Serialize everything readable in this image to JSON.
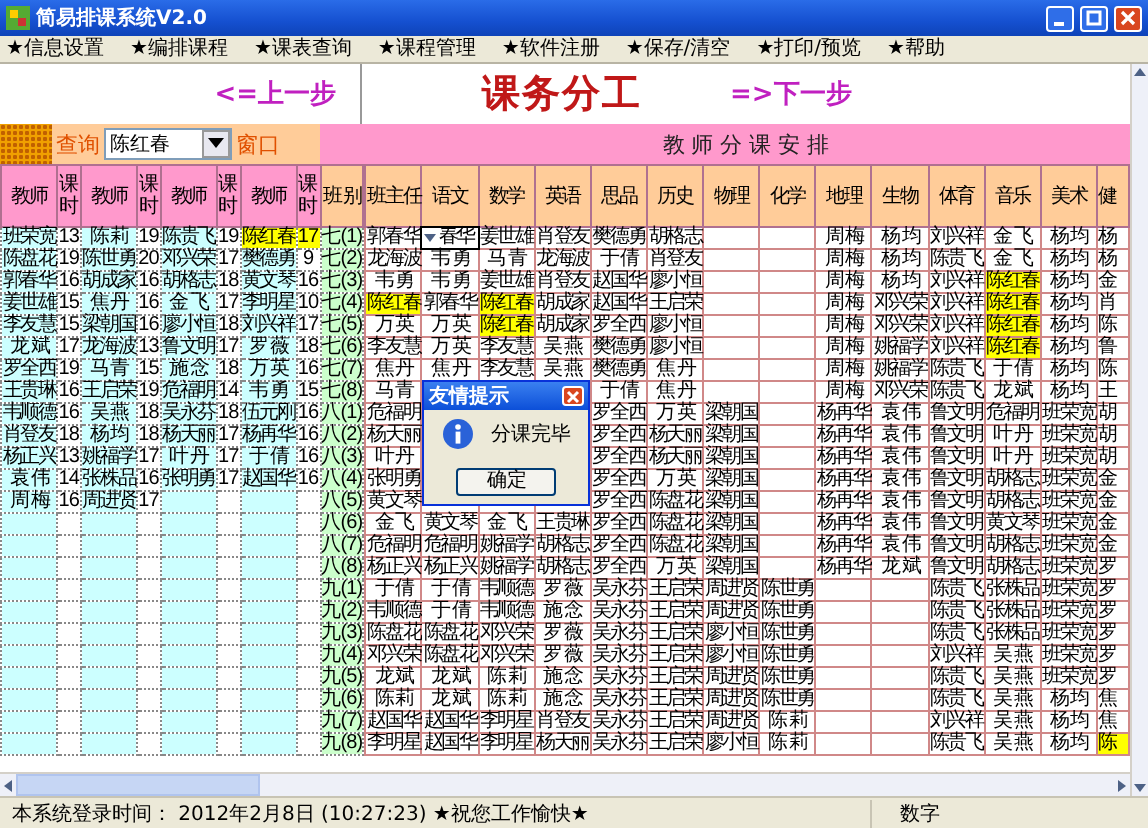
{
  "window": {
    "title": "简易排课系统V2.0"
  },
  "menu": [
    "★信息设置",
    "★编排课程",
    "★课表查询",
    "★课程管理",
    "★软件注册",
    "★保存/清空",
    "★打印/预览",
    "★帮助"
  ],
  "nav": {
    "prev": "<=上一步",
    "title": "课务分工",
    "next": "=>下一步"
  },
  "query": {
    "label": "查询",
    "value": "陈红春",
    "suffix": "窗口"
  },
  "banner": "教 师 分 课 安 排",
  "teacher_table": {
    "columns": [
      "教师",
      "课时",
      "教师",
      "课时",
      "教师",
      "课时",
      "教师",
      "课时",
      "班 别"
    ],
    "rows": [
      {
        "class": "七(1)",
        "entries": [
          {
            "teacher": "班荣宽",
            "hours": "13",
            "highlighted": false
          },
          {
            "teacher": "陈 莉",
            "hours": "19",
            "highlighted": false
          },
          {
            "teacher": "陈贵飞",
            "hours": "19",
            "highlighted": false
          },
          {
            "teacher": "陈红春",
            "hours": "17",
            "highlighted": true
          }
        ]
      },
      {
        "class": "七(2)",
        "entries": [
          {
            "teacher": "陈盘花",
            "hours": "19",
            "highlighted": false
          },
          {
            "teacher": "陈世勇",
            "hours": "20",
            "highlighted": false
          },
          {
            "teacher": "邓兴荣",
            "hours": "17",
            "highlighted": false
          },
          {
            "teacher": "樊德勇",
            "hours": "9",
            "highlighted": false
          }
        ]
      },
      {
        "class": "七(3)",
        "entries": [
          {
            "teacher": "郭春华",
            "hours": "16",
            "highlighted": false
          },
          {
            "teacher": "胡成家",
            "hours": "16",
            "highlighted": false
          },
          {
            "teacher": "胡格志",
            "hours": "18",
            "highlighted": false
          },
          {
            "teacher": "黄文琴",
            "hours": "16",
            "highlighted": false
          }
        ]
      },
      {
        "class": "七(4)",
        "entries": [
          {
            "teacher": "姜世雄",
            "hours": "15",
            "highlighted": false
          },
          {
            "teacher": "焦 丹",
            "hours": "16",
            "highlighted": false
          },
          {
            "teacher": "金 飞",
            "hours": "17",
            "highlighted": false
          },
          {
            "teacher": "李明星",
            "hours": "10",
            "highlighted": false
          }
        ]
      },
      {
        "class": "七(5)",
        "entries": [
          {
            "teacher": "李友慧",
            "hours": "15",
            "highlighted": false
          },
          {
            "teacher": "梁朝国",
            "hours": "16",
            "highlighted": false
          },
          {
            "teacher": "廖小恒",
            "hours": "18",
            "highlighted": false
          },
          {
            "teacher": "刘兴祥",
            "hours": "17",
            "highlighted": false
          }
        ]
      },
      {
        "class": "七(6)",
        "entries": [
          {
            "teacher": "龙 斌",
            "hours": "17",
            "highlighted": false
          },
          {
            "teacher": "龙海波",
            "hours": "13",
            "highlighted": false
          },
          {
            "teacher": "鲁文明",
            "hours": "17",
            "highlighted": false
          },
          {
            "teacher": "罗 薇",
            "hours": "18",
            "highlighted": false
          }
        ]
      },
      {
        "class": "七(7)",
        "entries": [
          {
            "teacher": "罗全西",
            "hours": "19",
            "highlighted": false
          },
          {
            "teacher": "马 青",
            "hours": "15",
            "highlighted": false
          },
          {
            "teacher": "施 念",
            "hours": "18",
            "highlighted": false
          },
          {
            "teacher": "万 英",
            "hours": "16",
            "highlighted": false
          }
        ]
      },
      {
        "class": "七(8)",
        "entries": [
          {
            "teacher": "王贵琳",
            "hours": "16",
            "highlighted": false
          },
          {
            "teacher": "王启荣",
            "hours": "19",
            "highlighted": false
          },
          {
            "teacher": "危福明",
            "hours": "14",
            "highlighted": false
          },
          {
            "teacher": "韦 勇",
            "hours": "15",
            "highlighted": false
          }
        ]
      },
      {
        "class": "八(1)",
        "entries": [
          {
            "teacher": "韦顺德",
            "hours": "16",
            "highlighted": false
          },
          {
            "teacher": "吴 燕",
            "hours": "18",
            "highlighted": false
          },
          {
            "teacher": "吴永芬",
            "hours": "18",
            "highlighted": false
          },
          {
            "teacher": "伍元刚",
            "hours": "16",
            "highlighted": false
          }
        ]
      },
      {
        "class": "八(2)",
        "entries": [
          {
            "teacher": "肖登友",
            "hours": "18",
            "highlighted": false
          },
          {
            "teacher": "杨 均",
            "hours": "18",
            "highlighted": false
          },
          {
            "teacher": "杨天丽",
            "hours": "17",
            "highlighted": false
          },
          {
            "teacher": "杨再华",
            "hours": "16",
            "highlighted": false
          }
        ]
      },
      {
        "class": "八(3)",
        "entries": [
          {
            "teacher": "杨正兴",
            "hours": "13",
            "highlighted": false
          },
          {
            "teacher": "姚福学",
            "hours": "17",
            "highlighted": false
          },
          {
            "teacher": "叶 丹",
            "hours": "17",
            "highlighted": false
          },
          {
            "teacher": "于 倩",
            "hours": "16",
            "highlighted": false
          }
        ]
      },
      {
        "class": "八(4)",
        "entries": [
          {
            "teacher": "袁 伟",
            "hours": "14",
            "highlighted": false
          },
          {
            "teacher": "张株品",
            "hours": "16",
            "highlighted": false
          },
          {
            "teacher": "张明勇",
            "hours": "17",
            "highlighted": false
          },
          {
            "teacher": "赵国华",
            "hours": "16",
            "highlighted": false
          }
        ]
      },
      {
        "class": "八(5)",
        "entries": [
          {
            "teacher": "周 梅",
            "hours": "16",
            "highlighted": false
          },
          {
            "teacher": "周进贤",
            "hours": "17",
            "highlighted": false
          }
        ]
      },
      {
        "class": "八(6)"
      },
      {
        "class": "八(7)"
      },
      {
        "class": "八(8)"
      },
      {
        "class": "九(1)"
      },
      {
        "class": "九(2)"
      },
      {
        "class": "九(3)"
      },
      {
        "class": "九(4)"
      },
      {
        "class": "九(5)"
      },
      {
        "class": "九(6)"
      },
      {
        "class": "九(7)"
      },
      {
        "class": "九(8)"
      }
    ]
  },
  "assignment_table": {
    "columns": [
      "班主任",
      "语文",
      "数学",
      "英语",
      "思品",
      "历史",
      "物理",
      "化学",
      "地理",
      "生物",
      "体育",
      "音乐",
      "美术",
      "健"
    ],
    "rows": [
      {
        "cells": [
          {
            "text": "郭春华",
            "highlighted": false
          },
          null,
          {
            "text": "姜世雄",
            "highlighted": false
          },
          {
            "text": "肖登友",
            "highlighted": false
          },
          {
            "text": "樊德勇",
            "highlighted": false
          },
          {
            "text": "胡格志",
            "highlighted": false
          },
          null,
          null,
          {
            "text": "周 梅",
            "highlighted": false
          },
          {
            "text": "杨 均",
            "highlighted": false
          },
          {
            "text": "刘兴祥",
            "highlighted": false
          },
          {
            "text": "金 飞",
            "highlighted": false
          },
          {
            "text": "杨 均",
            "highlighted": false
          },
          {
            "text": "杨",
            "highlighted": false
          }
        ]
      },
      {
        "cells": [
          {
            "text": "龙海波",
            "highlighted": false
          },
          {
            "text": "韦 勇",
            "highlighted": false
          },
          {
            "text": "马 青",
            "highlighted": false
          },
          {
            "text": "龙海波",
            "highlighted": false
          },
          {
            "text": "于 倩",
            "highlighted": false
          },
          {
            "text": "肖登友",
            "highlighted": false
          },
          null,
          null,
          {
            "text": "周 梅",
            "highlighted": false
          },
          {
            "text": "杨 均",
            "highlighted": false
          },
          {
            "text": "陈贵飞",
            "highlighted": false
          },
          {
            "text": "金 飞",
            "highlighted": false
          },
          {
            "text": "杨 均",
            "highlighted": false
          },
          {
            "text": "杨",
            "highlighted": false
          }
        ]
      },
      {
        "cells": [
          {
            "text": "韦 勇",
            "highlighted": false
          },
          {
            "text": "韦 勇",
            "highlighted": false
          },
          {
            "text": "姜世雄",
            "highlighted": false
          },
          {
            "text": "肖登友",
            "highlighted": false
          },
          {
            "text": "赵国华",
            "highlighted": false
          },
          {
            "text": "廖小恒",
            "highlighted": false
          },
          null,
          null,
          {
            "text": "周 梅",
            "highlighted": false
          },
          {
            "text": "杨 均",
            "highlighted": false
          },
          {
            "text": "刘兴祥",
            "highlighted": false
          },
          {
            "text": "陈红春",
            "highlighted": true
          },
          {
            "text": "杨 均",
            "highlighted": false
          },
          {
            "text": "金",
            "highlighted": false
          }
        ]
      },
      {
        "cells": [
          {
            "text": "陈红春",
            "highlighted": true
          },
          {
            "text": "郭春华",
            "highlighted": false
          },
          {
            "text": "陈红春",
            "highlighted": true
          },
          {
            "text": "胡成家",
            "highlighted": false
          },
          {
            "text": "赵国华",
            "highlighted": false
          },
          {
            "text": "王启荣",
            "highlighted": false
          },
          null,
          null,
          {
            "text": "周 梅",
            "highlighted": false
          },
          {
            "text": "邓兴荣",
            "highlighted": false
          },
          {
            "text": "刘兴祥",
            "highlighted": false
          },
          {
            "text": "陈红春",
            "highlighted": true
          },
          {
            "text": "杨 均",
            "highlighted": false
          },
          {
            "text": "肖",
            "highlighted": false
          }
        ]
      },
      {
        "cells": [
          {
            "text": "万 英",
            "highlighted": false
          },
          {
            "text": "万 英",
            "highlighted": false
          },
          {
            "text": "陈红春",
            "highlighted": true
          },
          {
            "text": "胡成家",
            "highlighted": false
          },
          {
            "text": "罗全西",
            "highlighted": false
          },
          {
            "text": "廖小恒",
            "highlighted": false
          },
          null,
          null,
          {
            "text": "周 梅",
            "highlighted": false
          },
          {
            "text": "邓兴荣",
            "highlighted": false
          },
          {
            "text": "刘兴祥",
            "highlighted": false
          },
          {
            "text": "陈红春",
            "highlighted": true
          },
          {
            "text": "杨 均",
            "highlighted": false
          },
          {
            "text": "陈",
            "highlighted": false
          }
        ]
      },
      {
        "cells": [
          {
            "text": "李友慧",
            "highlighted": false
          },
          {
            "text": "万 英",
            "highlighted": false
          },
          {
            "text": "李友慧",
            "highlighted": false
          },
          {
            "text": "吴 燕",
            "highlighted": false
          },
          {
            "text": "樊德勇",
            "highlighted": false
          },
          {
            "text": "廖小恒",
            "highlighted": false
          },
          null,
          null,
          {
            "text": "周 梅",
            "highlighted": false
          },
          {
            "text": "姚福学",
            "highlighted": false
          },
          {
            "text": "刘兴祥",
            "highlighted": false
          },
          {
            "text": "陈红春",
            "highlighted": true
          },
          {
            "text": "杨 均",
            "highlighted": false
          },
          {
            "text": "鲁",
            "highlighted": false
          }
        ]
      },
      {
        "cells": [
          {
            "text": "焦 丹",
            "highlighted": false
          },
          {
            "text": "焦 丹",
            "highlighted": false
          },
          {
            "text": "李友慧",
            "highlighted": false
          },
          {
            "text": "吴 燕",
            "highlighted": false
          },
          {
            "text": "樊德勇",
            "highlighted": false
          },
          {
            "text": "焦 丹",
            "highlighted": false
          },
          null,
          null,
          {
            "text": "周 梅",
            "highlighted": false
          },
          {
            "text": "姚福学",
            "highlighted": false
          },
          {
            "text": "陈贵飞",
            "highlighted": false
          },
          {
            "text": "于 倩",
            "highlighted": false
          },
          {
            "text": "杨 均",
            "highlighted": false
          },
          {
            "text": "陈",
            "highlighted": false
          }
        ]
      },
      {
        "cells": [
          {
            "text": "马 青",
            "highlighted": false
          },
          null,
          null,
          null,
          {
            "text": "于 倩",
            "highlighted": false
          },
          {
            "text": "焦 丹",
            "highlighted": false
          },
          null,
          null,
          {
            "text": "周 梅",
            "highlighted": false
          },
          {
            "text": "邓兴荣",
            "highlighted": false
          },
          {
            "text": "陈贵飞",
            "highlighted": false
          },
          {
            "text": "龙 斌",
            "highlighted": false
          },
          {
            "text": "杨 均",
            "highlighted": false
          },
          {
            "text": "王",
            "highlighted": false
          }
        ]
      },
      {
        "cells": [
          {
            "text": "危福明",
            "highlighted": false
          },
          null,
          null,
          null,
          {
            "text": "罗全西",
            "highlighted": false
          },
          {
            "text": "万 英",
            "highlighted": false
          },
          {
            "text": "梁朝国",
            "highlighted": false
          },
          null,
          {
            "text": "杨再华",
            "highlighted": false
          },
          {
            "text": "袁 伟",
            "highlighted": false
          },
          {
            "text": "鲁文明",
            "highlighted": false
          },
          {
            "text": "危福明",
            "highlighted": false
          },
          {
            "text": "班荣宽",
            "highlighted": false
          },
          {
            "text": "胡",
            "highlighted": false
          }
        ]
      },
      {
        "cells": [
          {
            "text": "杨天丽",
            "highlighted": false
          },
          null,
          null,
          null,
          {
            "text": "罗全西",
            "highlighted": false
          },
          {
            "text": "杨天丽",
            "highlighted": false
          },
          {
            "text": "梁朝国",
            "highlighted": false
          },
          null,
          {
            "text": "杨再华",
            "highlighted": false
          },
          {
            "text": "袁 伟",
            "highlighted": false
          },
          {
            "text": "鲁文明",
            "highlighted": false
          },
          {
            "text": "叶 丹",
            "highlighted": false
          },
          {
            "text": "班荣宽",
            "highlighted": false
          },
          {
            "text": "胡",
            "highlighted": false
          }
        ]
      },
      {
        "cells": [
          {
            "text": "叶 丹",
            "highlighted": false
          },
          null,
          null,
          null,
          {
            "text": "罗全西",
            "highlighted": false
          },
          {
            "text": "杨天丽",
            "highlighted": false
          },
          {
            "text": "梁朝国",
            "highlighted": false
          },
          null,
          {
            "text": "杨再华",
            "highlighted": false
          },
          {
            "text": "袁 伟",
            "highlighted": false
          },
          {
            "text": "鲁文明",
            "highlighted": false
          },
          {
            "text": "叶 丹",
            "highlighted": false
          },
          {
            "text": "班荣宽",
            "highlighted": false
          },
          {
            "text": "胡",
            "highlighted": false
          }
        ]
      },
      {
        "cells": [
          {
            "text": "张明勇",
            "highlighted": false
          },
          null,
          null,
          null,
          {
            "text": "罗全西",
            "highlighted": false
          },
          {
            "text": "万 英",
            "highlighted": false
          },
          {
            "text": "梁朝国",
            "highlighted": false
          },
          null,
          {
            "text": "杨再华",
            "highlighted": false
          },
          {
            "text": "袁 伟",
            "highlighted": false
          },
          {
            "text": "鲁文明",
            "highlighted": false
          },
          {
            "text": "胡格志",
            "highlighted": false
          },
          {
            "text": "班荣宽",
            "highlighted": false
          },
          {
            "text": "金",
            "highlighted": false
          }
        ]
      },
      {
        "cells": [
          {
            "text": "黄文琴",
            "highlighted": false
          },
          null,
          null,
          null,
          {
            "text": "罗全西",
            "highlighted": false
          },
          {
            "text": "陈盘花",
            "highlighted": false
          },
          {
            "text": "梁朝国",
            "highlighted": false
          },
          null,
          {
            "text": "杨再华",
            "highlighted": false
          },
          {
            "text": "袁 伟",
            "highlighted": false
          },
          {
            "text": "鲁文明",
            "highlighted": false
          },
          {
            "text": "胡格志",
            "highlighted": false
          },
          {
            "text": "班荣宽",
            "highlighted": false
          },
          {
            "text": "金",
            "highlighted": false
          }
        ]
      },
      {
        "cells": [
          {
            "text": "金 飞",
            "highlighted": false
          },
          {
            "text": "黄文琴",
            "highlighted": false
          },
          {
            "text": "金 飞",
            "highlighted": false
          },
          {
            "text": "王贵琳",
            "highlighted": false
          },
          {
            "text": "罗全西",
            "highlighted": false
          },
          {
            "text": "陈盘花",
            "highlighted": false
          },
          {
            "text": "梁朝国",
            "highlighted": false
          },
          null,
          {
            "text": "杨再华",
            "highlighted": false
          },
          {
            "text": "袁 伟",
            "highlighted": false
          },
          {
            "text": "鲁文明",
            "highlighted": false
          },
          {
            "text": "黄文琴",
            "highlighted": false
          },
          {
            "text": "班荣宽",
            "highlighted": false
          },
          {
            "text": "金",
            "highlighted": false
          }
        ]
      },
      {
        "cells": [
          {
            "text": "危福明",
            "highlighted": false
          },
          {
            "text": "危福明",
            "highlighted": false
          },
          {
            "text": "姚福学",
            "highlighted": false
          },
          {
            "text": "胡格志",
            "highlighted": false
          },
          {
            "text": "罗全西",
            "highlighted": false
          },
          {
            "text": "陈盘花",
            "highlighted": false
          },
          {
            "text": "梁朝国",
            "highlighted": false
          },
          null,
          {
            "text": "杨再华",
            "highlighted": false
          },
          {
            "text": "袁 伟",
            "highlighted": false
          },
          {
            "text": "鲁文明",
            "highlighted": false
          },
          {
            "text": "胡格志",
            "highlighted": false
          },
          {
            "text": "班荣宽",
            "highlighted": false
          },
          {
            "text": "金",
            "highlighted": false
          }
        ]
      },
      {
        "cells": [
          {
            "text": "杨正兴",
            "highlighted": false
          },
          {
            "text": "杨正兴",
            "highlighted": false
          },
          {
            "text": "姚福学",
            "highlighted": false
          },
          {
            "text": "胡格志",
            "highlighted": false
          },
          {
            "text": "罗全西",
            "highlighted": false
          },
          {
            "text": "万 英",
            "highlighted": false
          },
          {
            "text": "梁朝国",
            "highlighted": false
          },
          null,
          {
            "text": "杨再华",
            "highlighted": false
          },
          {
            "text": "龙 斌",
            "highlighted": false
          },
          {
            "text": "鲁文明",
            "highlighted": false
          },
          {
            "text": "胡格志",
            "highlighted": false
          },
          {
            "text": "班荣宽",
            "highlighted": false
          },
          {
            "text": "罗",
            "highlighted": false
          }
        ]
      },
      {
        "cells": [
          {
            "text": "于 倩",
            "highlighted": false
          },
          {
            "text": "于 倩",
            "highlighted": false
          },
          {
            "text": "韦顺德",
            "highlighted": false
          },
          {
            "text": "罗 薇",
            "highlighted": false
          },
          {
            "text": "吴永芬",
            "highlighted": false
          },
          {
            "text": "王启荣",
            "highlighted": false
          },
          {
            "text": "周进贤",
            "highlighted": false
          },
          {
            "text": "陈世勇",
            "highlighted": false
          },
          null,
          null,
          {
            "text": "陈贵飞",
            "highlighted": false
          },
          {
            "text": "张株品",
            "highlighted": false
          },
          {
            "text": "班荣宽",
            "highlighted": false
          },
          {
            "text": "罗",
            "highlighted": false
          }
        ]
      },
      {
        "cells": [
          {
            "text": "韦顺德",
            "highlighted": false
          },
          {
            "text": "于 倩",
            "highlighted": false
          },
          {
            "text": "韦顺德",
            "highlighted": false
          },
          {
            "text": "施 念",
            "highlighted": false
          },
          {
            "text": "吴永芬",
            "highlighted": false
          },
          {
            "text": "王启荣",
            "highlighted": false
          },
          {
            "text": "周进贤",
            "highlighted": false
          },
          {
            "text": "陈世勇",
            "highlighted": false
          },
          null,
          null,
          {
            "text": "陈贵飞",
            "highlighted": false
          },
          {
            "text": "张株品",
            "highlighted": false
          },
          {
            "text": "班荣宽",
            "highlighted": false
          },
          {
            "text": "罗",
            "highlighted": false
          }
        ]
      },
      {
        "cells": [
          {
            "text": "陈盘花",
            "highlighted": false
          },
          {
            "text": "陈盘花",
            "highlighted": false
          },
          {
            "text": "邓兴荣",
            "highlighted": false
          },
          {
            "text": "罗 薇",
            "highlighted": false
          },
          {
            "text": "吴永芬",
            "highlighted": false
          },
          {
            "text": "王启荣",
            "highlighted": false
          },
          {
            "text": "廖小恒",
            "highlighted": false
          },
          {
            "text": "陈世勇",
            "highlighted": false
          },
          null,
          null,
          {
            "text": "陈贵飞",
            "highlighted": false
          },
          {
            "text": "张株品",
            "highlighted": false
          },
          {
            "text": "班荣宽",
            "highlighted": false
          },
          {
            "text": "罗",
            "highlighted": false
          }
        ]
      },
      {
        "cells": [
          {
            "text": "邓兴荣",
            "highlighted": false
          },
          {
            "text": "陈盘花",
            "highlighted": false
          },
          {
            "text": "邓兴荣",
            "highlighted": false
          },
          {
            "text": "罗 薇",
            "highlighted": false
          },
          {
            "text": "吴永芬",
            "highlighted": false
          },
          {
            "text": "王启荣",
            "highlighted": false
          },
          {
            "text": "廖小恒",
            "highlighted": false
          },
          {
            "text": "陈世勇",
            "highlighted": false
          },
          null,
          null,
          {
            "text": "刘兴祥",
            "highlighted": false
          },
          {
            "text": "吴 燕",
            "highlighted": false
          },
          {
            "text": "班荣宽",
            "highlighted": false
          },
          {
            "text": "罗",
            "highlighted": false
          }
        ]
      },
      {
        "cells": [
          {
            "text": "龙 斌",
            "highlighted": false
          },
          {
            "text": "龙 斌",
            "highlighted": false
          },
          {
            "text": "陈 莉",
            "highlighted": false
          },
          {
            "text": "施 念",
            "highlighted": false
          },
          {
            "text": "吴永芬",
            "highlighted": false
          },
          {
            "text": "王启荣",
            "highlighted": false
          },
          {
            "text": "周进贤",
            "highlighted": false
          },
          {
            "text": "陈世勇",
            "highlighted": false
          },
          null,
          null,
          {
            "text": "陈贵飞",
            "highlighted": false
          },
          {
            "text": "吴 燕",
            "highlighted": false
          },
          {
            "text": "班荣宽",
            "highlighted": false
          },
          {
            "text": "罗",
            "highlighted": false
          }
        ]
      },
      {
        "cells": [
          {
            "text": "陈 莉",
            "highlighted": false
          },
          {
            "text": "龙 斌",
            "highlighted": false
          },
          {
            "text": "陈 莉",
            "highlighted": false
          },
          {
            "text": "施 念",
            "highlighted": false
          },
          {
            "text": "吴永芬",
            "highlighted": false
          },
          {
            "text": "王启荣",
            "highlighted": false
          },
          {
            "text": "周进贤",
            "highlighted": false
          },
          {
            "text": "陈世勇",
            "highlighted": false
          },
          null,
          null,
          {
            "text": "陈贵飞",
            "highlighted": false
          },
          {
            "text": "吴 燕",
            "highlighted": false
          },
          {
            "text": "杨 均",
            "highlighted": false
          },
          {
            "text": "焦",
            "highlighted": false
          }
        ]
      },
      {
        "cells": [
          {
            "text": "赵国华",
            "highlighted": false
          },
          {
            "text": "赵国华",
            "highlighted": false
          },
          {
            "text": "李明星",
            "highlighted": false
          },
          {
            "text": "肖登友",
            "highlighted": false
          },
          {
            "text": "吴永芬",
            "highlighted": false
          },
          {
            "text": "王启荣",
            "highlighted": false
          },
          {
            "text": "周进贤",
            "highlighted": false
          },
          {
            "text": "陈 莉",
            "highlighted": false
          },
          null,
          null,
          {
            "text": "刘兴祥",
            "highlighted": false
          },
          {
            "text": "吴 燕",
            "highlighted": false
          },
          {
            "text": "杨 均",
            "highlighted": false
          },
          {
            "text": "焦",
            "highlighted": false
          }
        ]
      },
      {
        "cells": [
          {
            "text": "李明星",
            "highlighted": false
          },
          {
            "text": "赵国华",
            "highlighted": false
          },
          {
            "text": "李明星",
            "highlighted": false
          },
          {
            "text": "杨天丽",
            "highlighted": false
          },
          {
            "text": "吴永芬",
            "highlighted": false
          },
          {
            "text": "王启荣",
            "highlighted": false
          },
          {
            "text": "廖小恒",
            "highlighted": false
          },
          {
            "text": "陈 莉",
            "highlighted": false
          },
          null,
          null,
          {
            "text": "陈贵飞",
            "highlighted": false
          },
          {
            "text": "吴 燕",
            "highlighted": false
          },
          {
            "text": "杨 均",
            "highlighted": false
          },
          {
            "text": "陈",
            "highlighted": true
          }
        ]
      }
    ]
  },
  "cell_editor": {
    "text": "春华"
  },
  "dialog": {
    "title": "友情提示",
    "message": "分课完毕",
    "button": "确定"
  },
  "status_bar": {
    "login": "本系统登录时间： 2012年2月8日 (10:27:23) ★祝您工作愉快★",
    "mode": "数字"
  }
}
